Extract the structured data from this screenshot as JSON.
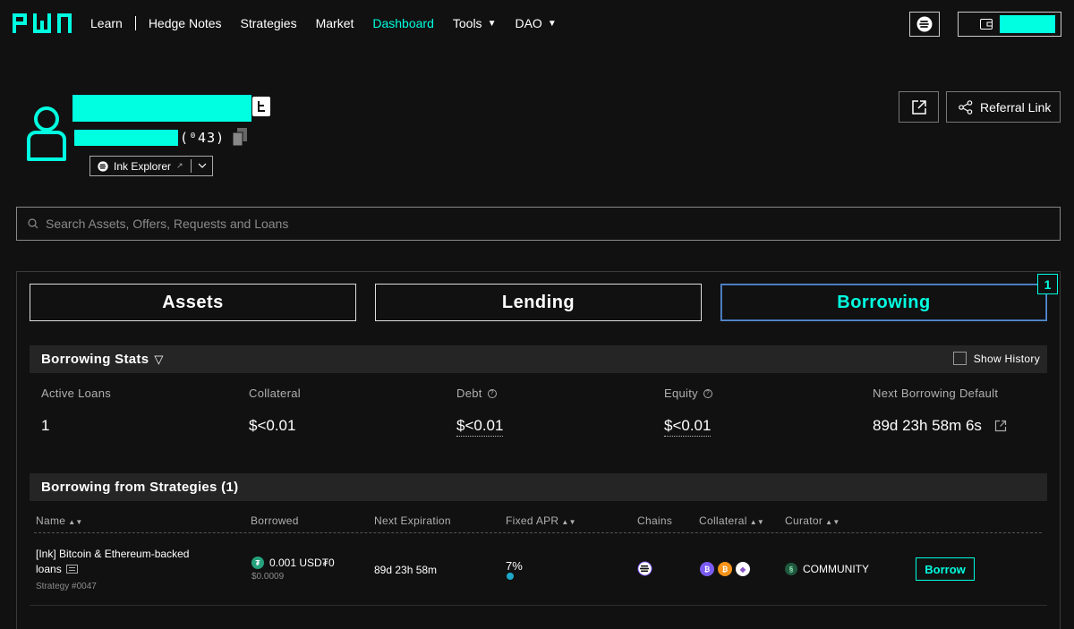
{
  "nav": {
    "logo": "PWN",
    "links": {
      "learn": "Learn",
      "hedge_notes": "Hedge Notes",
      "strategies": "Strategies",
      "market": "Market",
      "dashboard": "Dashboard",
      "tools": "Tools",
      "dao": "DAO"
    },
    "accent_color": "#00ffe0"
  },
  "profile": {
    "address_suffix": "(⁰43)",
    "explorer_label": "Ink Explorer",
    "referral_label": "Referral Link"
  },
  "search": {
    "placeholder": "Search Assets, Offers, Requests and Loans"
  },
  "tabs": {
    "assets": "Assets",
    "lending": "Lending",
    "borrowing": "Borrowing",
    "active": "Borrowing",
    "borrowing_count": "1"
  },
  "stats": {
    "title": "Borrowing Stats",
    "show_history": "Show History",
    "labels": {
      "active_loans": "Active Loans",
      "collateral": "Collateral",
      "debt": "Debt",
      "equity": "Equity",
      "next_default": "Next Borrowing Default"
    },
    "values": {
      "active_loans": "1",
      "collateral": "$<0.01",
      "debt": "$<0.01",
      "equity": "$<0.01",
      "next_default": "89d 23h 58m 6s"
    }
  },
  "strategies": {
    "title": "Borrowing from Strategies (1)",
    "columns": {
      "name": "Name",
      "borrowed": "Borrowed",
      "next_expiration": "Next Expiration",
      "fixed_apr": "Fixed APR",
      "chains": "Chains",
      "collateral": "Collateral",
      "curator": "Curator"
    },
    "row": {
      "name_line1": "[Ink] Bitcoin & Ethereum-backed",
      "name_line2": "loans",
      "strategy_id": "Strategy #0047",
      "borrowed_amount": "0.001 USD₮0",
      "borrowed_usd": "$0.0009",
      "next_expiration": "89d 23h 58m",
      "fixed_apr": "7%",
      "curator": "COMMUNITY",
      "action": "Borrow"
    }
  }
}
